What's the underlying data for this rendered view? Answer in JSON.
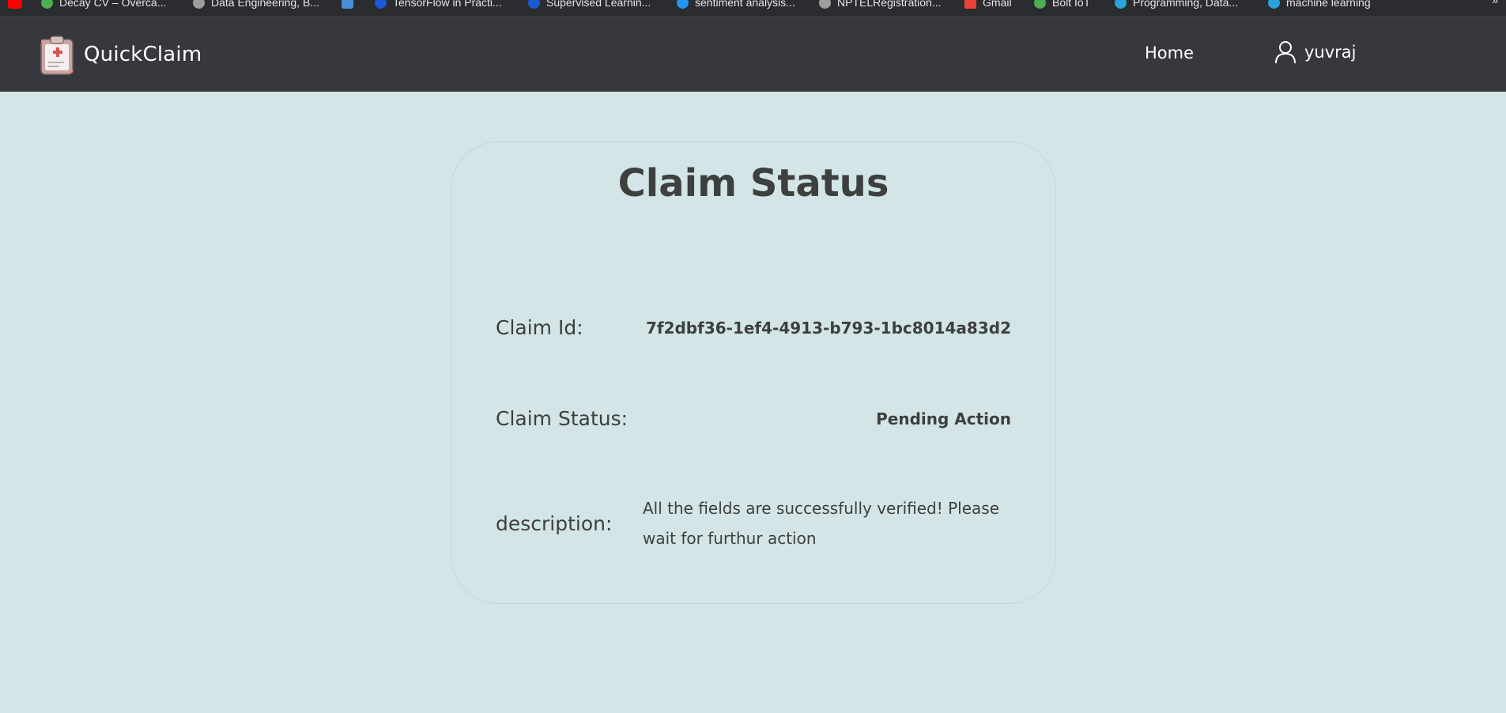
{
  "bookmarks": {
    "items": [
      {
        "label": "Decay CV – Overca...",
        "color": "#4caf50"
      },
      {
        "label": "Data Engineering, B...",
        "color": "#9e9e9e"
      },
      {
        "label": "",
        "color": "#4a8fd8"
      },
      {
        "label": "TensorFlow in Practi...",
        "color": "#1a5ad6"
      },
      {
        "label": "Supervised Learnin...",
        "color": "#1a5ad6"
      },
      {
        "label": "sentiment analysis...",
        "color": "#2196f3"
      },
      {
        "label": "NPTELRegistration...",
        "color": "#9e9e9e"
      },
      {
        "label": "Gmail",
        "color": "#ea4335"
      },
      {
        "label": "Bolt IoT",
        "color": "#4caf50"
      },
      {
        "label": "Programming, Data...",
        "color": "#29a3d9"
      },
      {
        "label": "machine learning",
        "color": "#29a3d9"
      }
    ],
    "more": "»"
  },
  "navbar": {
    "brand": "QuickClaim",
    "home": "Home",
    "user": "yuvraj"
  },
  "card": {
    "title": "Claim Status",
    "claim_id_label": "Claim Id:",
    "claim_id_value": "7f2dbf36-1ef4-4913-b793-1bc8014a83d2",
    "status_label": "Claim Status:",
    "status_value": "Pending Action",
    "description_label": "description:",
    "description_value": "All the fields are successfully verified! Please wait for furthur action"
  },
  "colors": {
    "page_background": "#d3e5e6",
    "navbar_background": "#37383d",
    "text": "#3e3f3f"
  }
}
